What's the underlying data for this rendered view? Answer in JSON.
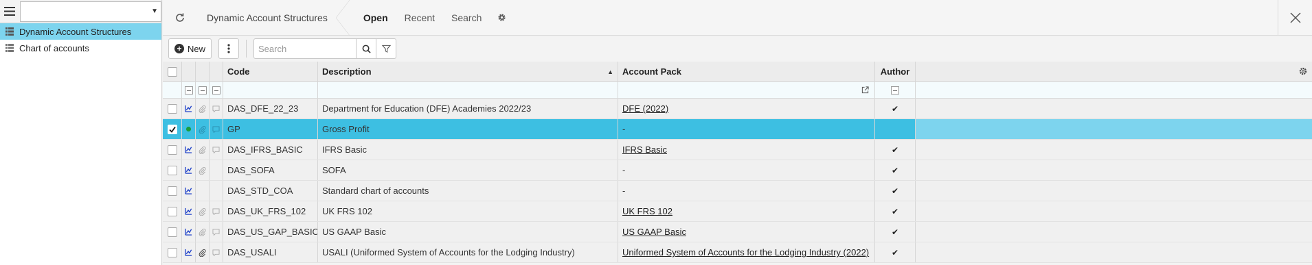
{
  "sidebar": {
    "select_value": "",
    "items": [
      {
        "label": "Dynamic Account Structures",
        "active": true
      },
      {
        "label": "Chart of accounts",
        "active": false
      }
    ]
  },
  "header": {
    "breadcrumb": "Dynamic Account Structures",
    "tabs": [
      "Open",
      "Recent",
      "Search"
    ]
  },
  "toolbar": {
    "new_label": "New",
    "search_placeholder": "Search"
  },
  "table": {
    "columns": {
      "code": "Code",
      "description": "Description",
      "account_pack": "Account Pack",
      "author": "Author"
    },
    "sort_indicator": "▲",
    "rows": [
      {
        "code": "DAS_DFE_22_23",
        "description": "Department for Education (DFE) Academies 2022/23",
        "account_pack": "DFE (2022)",
        "pack_link": true,
        "author": "✔",
        "selected": false
      },
      {
        "code": "GP",
        "description": "Gross Profit",
        "account_pack": "-",
        "pack_link": false,
        "author": "",
        "selected": true
      },
      {
        "code": "DAS_IFRS_BASIC",
        "description": "IFRS Basic",
        "account_pack": "IFRS Basic",
        "pack_link": true,
        "author": "✔",
        "selected": false
      },
      {
        "code": "DAS_SOFA",
        "description": "SOFA",
        "account_pack": "-",
        "pack_link": false,
        "author": "✔",
        "selected": false
      },
      {
        "code": "DAS_STD_COA",
        "description": "Standard chart of accounts",
        "account_pack": "-",
        "pack_link": false,
        "author": "✔",
        "selected": false
      },
      {
        "code": "DAS_UK_FRS_102",
        "description": "UK FRS 102",
        "account_pack": "UK FRS 102",
        "pack_link": true,
        "author": "✔",
        "selected": false
      },
      {
        "code": "DAS_US_GAP_BASIC",
        "description": "US GAAP Basic",
        "account_pack": "US GAAP Basic",
        "pack_link": true,
        "author": "✔",
        "selected": false
      },
      {
        "code": "DAS_USALI",
        "description": "USALI (Uniformed System of Accounts for the Lodging Industry)",
        "account_pack": "Uniformed System of Accounts for the Lodging Industry (2022)",
        "pack_link": true,
        "author": "✔",
        "selected": false
      }
    ]
  },
  "colors": {
    "accent": "#3dbfe2",
    "accent_light": "#7dd4ee",
    "link_icon": "#1c3fc8",
    "status_dot": "#1a9e3a"
  }
}
